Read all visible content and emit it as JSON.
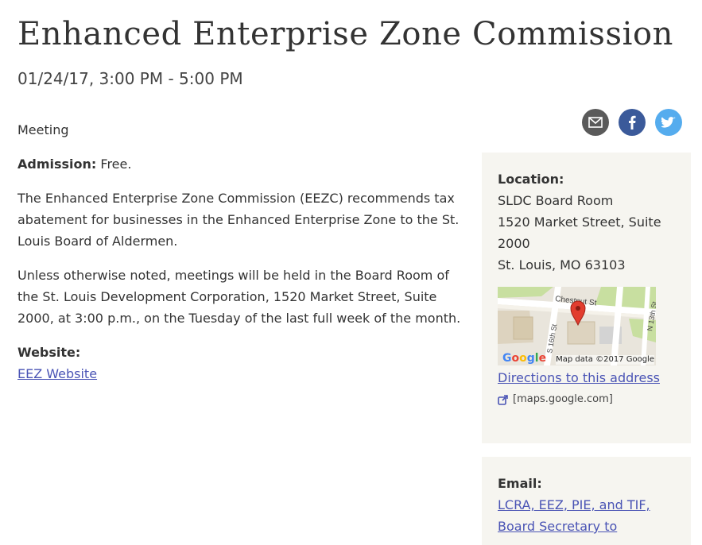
{
  "event": {
    "title": "Enhanced Enterprise Zone Commission",
    "datetime": "01/24/17, 3:00 PM - 5:00 PM",
    "type": "Meeting",
    "admission_label": "Admission:",
    "admission_value": " Free.",
    "description": [
      "The Enhanced Enterprise Zone Commission (EEZC) recommends tax abatement for businesses in the Enhanced Enterprise Zone to the St. Louis Board of Aldermen.",
      "Unless otherwise noted, meetings will be held in the Board Room of the St. Louis Development Corporation, 1520 Market Street, Suite 2000, at 3:00 p.m., on the Tuesday of the last full week of the month."
    ],
    "website_label": "Website:",
    "website_link": "EEZ Website"
  },
  "share": {
    "icons": [
      "email-icon",
      "facebook-icon",
      "twitter-icon"
    ],
    "colors": {
      "email": "#5a5a5a",
      "facebook": "#3b5a9a",
      "twitter": "#55acee"
    }
  },
  "location": {
    "label": "Location:",
    "venue": "SLDC Board Room",
    "street_1": "1520 Market Street, Suite",
    "street_2": "2000",
    "city": "St. Louis, MO 63103",
    "map": {
      "street_labels": [
        "Chestnut St",
        "S 16th St",
        "N 13th St"
      ],
      "logo": "Google",
      "attribution": "Map data ©2017 Google"
    },
    "directions_link": "Directions to this address",
    "external_domain": "[maps.google.com]"
  },
  "email_section": {
    "label": "Email:",
    "links": [
      "LCRA, EEZ, PIE, and TIF,",
      "Board Secretary to"
    ]
  },
  "colors": {
    "link": "#4a54b5",
    "sidebar_bg": "#f6f5f0",
    "text": "#333333"
  }
}
